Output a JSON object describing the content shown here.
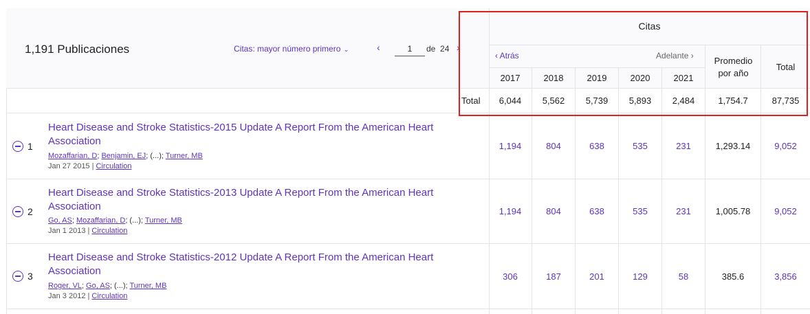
{
  "header": {
    "pub_count": "1,191 Publicaciones",
    "sort_label": "Citas: mayor número primero",
    "page_current": "1",
    "page_of": "de",
    "page_total": "24"
  },
  "citations": {
    "title": "Citas",
    "back": "Atrás",
    "forward": "Adelante",
    "years": [
      "2017",
      "2018",
      "2019",
      "2020",
      "2021"
    ],
    "avg_header_line1": "Promedio",
    "avg_header_line2": "por año",
    "total_header": "Total",
    "totals_label": "Total",
    "totals": [
      "6,044",
      "5,562",
      "5,739",
      "5,893",
      "2,484",
      "1,754.7",
      "87,735"
    ]
  },
  "rows": [
    {
      "num": "1",
      "title_line1": "Heart Disease and Stroke Statistics-2015 Update A Report From the American Heart",
      "title_line2": "Association",
      "author1": "Mozaffarian, D",
      "author2": "Benjamin, EJ",
      "author_mid": "; (...); ",
      "author3": "Turner, MB",
      "date": "Jan 27 2015 | ",
      "journal": "Circulation",
      "values": [
        "1,194",
        "804",
        "638",
        "535",
        "231"
      ],
      "avg": "1,293.14",
      "total": "9,052"
    },
    {
      "num": "2",
      "title_line1": "Heart Disease and Stroke Statistics-2013 Update A Report From the American Heart",
      "title_line2": "Association",
      "author1": "Go, AS",
      "author2": "Mozaffarian, D",
      "author_mid": "; (...); ",
      "author3": "Turner, MB",
      "date": "Jan 1 2013 | ",
      "journal": "Circulation",
      "values": [
        "1,194",
        "804",
        "638",
        "535",
        "231"
      ],
      "avg": "1,005.78",
      "total": "9,052"
    },
    {
      "num": "3",
      "title_line1": "Heart Disease and Stroke Statistics-2012 Update A Report From the American Heart",
      "title_line2": "Association",
      "author1": "Roger, VL",
      "author2": "Go, AS",
      "author_mid": "; (...); ",
      "author3": "Turner, MB",
      "date": "Jan 3 2012 | ",
      "journal": "Circulation",
      "values": [
        "306",
        "187",
        "201",
        "129",
        "58"
      ],
      "avg": "385.6",
      "total": "3,856"
    }
  ],
  "colors": {
    "accent": "#5e33bf",
    "highlight_border": "#e02020",
    "grid": "#e3e3ec"
  }
}
